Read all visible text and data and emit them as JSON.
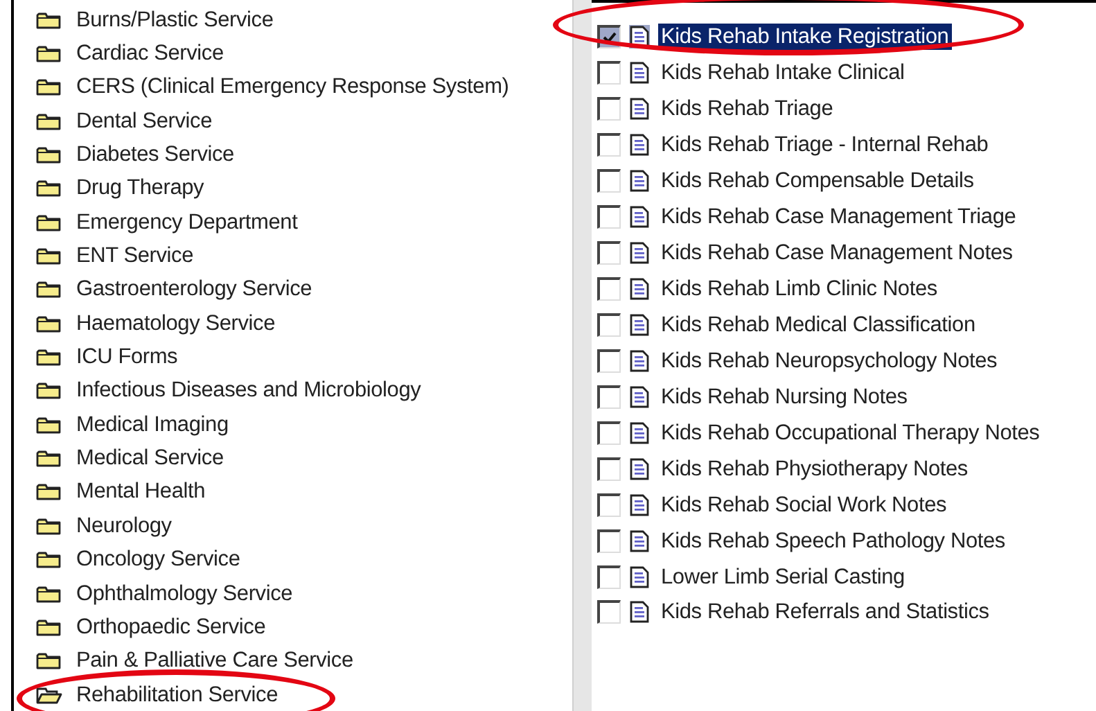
{
  "folders": [
    {
      "label": "Burns/Plastic Service",
      "expanded": false,
      "highlighted": false
    },
    {
      "label": "Cardiac Service",
      "expanded": false,
      "highlighted": false
    },
    {
      "label": "CERS (Clinical Emergency Response System)",
      "expanded": false,
      "highlighted": false
    },
    {
      "label": "Dental Service",
      "expanded": false,
      "highlighted": false
    },
    {
      "label": "Diabetes Service",
      "expanded": false,
      "highlighted": false
    },
    {
      "label": "Drug Therapy",
      "expanded": false,
      "highlighted": false
    },
    {
      "label": "Emergency Department",
      "expanded": false,
      "highlighted": false
    },
    {
      "label": "ENT Service",
      "expanded": false,
      "highlighted": false
    },
    {
      "label": "Gastroenterology Service",
      "expanded": false,
      "highlighted": false
    },
    {
      "label": "Haematology Service",
      "expanded": false,
      "highlighted": false
    },
    {
      "label": "ICU Forms",
      "expanded": false,
      "highlighted": false
    },
    {
      "label": "Infectious Diseases and Microbiology",
      "expanded": false,
      "highlighted": false
    },
    {
      "label": "Medical Imaging",
      "expanded": false,
      "highlighted": false
    },
    {
      "label": "Medical Service",
      "expanded": false,
      "highlighted": false
    },
    {
      "label": "Mental Health",
      "expanded": false,
      "highlighted": false
    },
    {
      "label": "Neurology",
      "expanded": false,
      "highlighted": false
    },
    {
      "label": "Oncology Service",
      "expanded": false,
      "highlighted": false
    },
    {
      "label": "Ophthalmology Service",
      "expanded": false,
      "highlighted": false
    },
    {
      "label": "Orthopaedic Service",
      "expanded": false,
      "highlighted": false
    },
    {
      "label": "Pain & Palliative Care Service",
      "expanded": false,
      "highlighted": false
    },
    {
      "label": "Rehabilitation Service",
      "expanded": true,
      "highlighted": true
    }
  ],
  "forms": [
    {
      "label": "Kids Rehab Intake Registration",
      "checked": true,
      "selected": true,
      "highlighted": true
    },
    {
      "label": "Kids Rehab Intake Clinical",
      "checked": false,
      "selected": false,
      "highlighted": false
    },
    {
      "label": "Kids Rehab Triage",
      "checked": false,
      "selected": false,
      "highlighted": false
    },
    {
      "label": "Kids Rehab Triage - Internal Rehab",
      "checked": false,
      "selected": false,
      "highlighted": false
    },
    {
      "label": "Kids Rehab Compensable Details",
      "checked": false,
      "selected": false,
      "highlighted": false
    },
    {
      "label": "Kids Rehab Case Management Triage",
      "checked": false,
      "selected": false,
      "highlighted": false
    },
    {
      "label": "Kids Rehab Case Management Notes",
      "checked": false,
      "selected": false,
      "highlighted": false
    },
    {
      "label": "Kids Rehab Limb Clinic Notes",
      "checked": false,
      "selected": false,
      "highlighted": false
    },
    {
      "label": "Kids Rehab Medical Classification",
      "checked": false,
      "selected": false,
      "highlighted": false
    },
    {
      "label": "Kids Rehab Neuropsychology Notes",
      "checked": false,
      "selected": false,
      "highlighted": false
    },
    {
      "label": "Kids Rehab Nursing Notes",
      "checked": false,
      "selected": false,
      "highlighted": false
    },
    {
      "label": "Kids Rehab Occupational Therapy Notes",
      "checked": false,
      "selected": false,
      "highlighted": false
    },
    {
      "label": "Kids Rehab Physiotherapy Notes",
      "checked": false,
      "selected": false,
      "highlighted": false
    },
    {
      "label": "Kids Rehab Social Work Notes",
      "checked": false,
      "selected": false,
      "highlighted": false
    },
    {
      "label": "Kids Rehab Speech Pathology Notes",
      "checked": false,
      "selected": false,
      "highlighted": false
    },
    {
      "label": "Lower Limb Serial Casting",
      "checked": false,
      "selected": false,
      "highlighted": false
    },
    {
      "label": "Kids Rehab Referrals and Statistics",
      "checked": false,
      "selected": false,
      "highlighted": false
    }
  ]
}
